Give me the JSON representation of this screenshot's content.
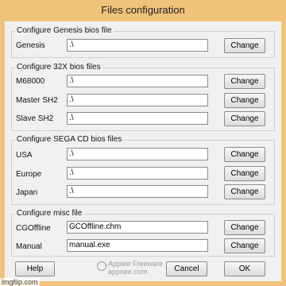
{
  "window": {
    "title": "Files configuration"
  },
  "groups": {
    "genesis": {
      "legend": "Configure Genesis bios file",
      "rows": [
        {
          "label": "Genesis",
          "value": ".\\",
          "button": "Change"
        }
      ]
    },
    "s32x": {
      "legend": "Configure 32X bios files",
      "rows": [
        {
          "label": "M68000",
          "value": ".\\",
          "button": "Change"
        },
        {
          "label": "Master SH2",
          "value": ".\\",
          "button": "Change"
        },
        {
          "label": "Slave SH2",
          "value": ".\\",
          "button": "Change"
        }
      ]
    },
    "segacd": {
      "legend": "Configure SEGA CD bios files",
      "rows": [
        {
          "label": "USA",
          "value": ".\\",
          "button": "Change"
        },
        {
          "label": "Europe",
          "value": ".\\",
          "button": "Change"
        },
        {
          "label": "Japan",
          "value": ".\\",
          "button": "Change"
        }
      ]
    },
    "misc": {
      "legend": "Configure misc file",
      "rows": [
        {
          "label": "CGOffline",
          "value": "GCOffline.chm",
          "button": "Change"
        },
        {
          "label": "Manual",
          "value": "manual.exe",
          "button": "Change"
        }
      ]
    }
  },
  "footer": {
    "help": "Help",
    "cancel": "Cancel",
    "ok": "OK"
  },
  "watermark": {
    "site": "imgflip.com",
    "overlay_line1": "Apptee Freeware",
    "overlay_line2": "appnee.com"
  },
  "colors": {
    "titlebar": "#f0c27a",
    "client": "#f0f0f0"
  }
}
